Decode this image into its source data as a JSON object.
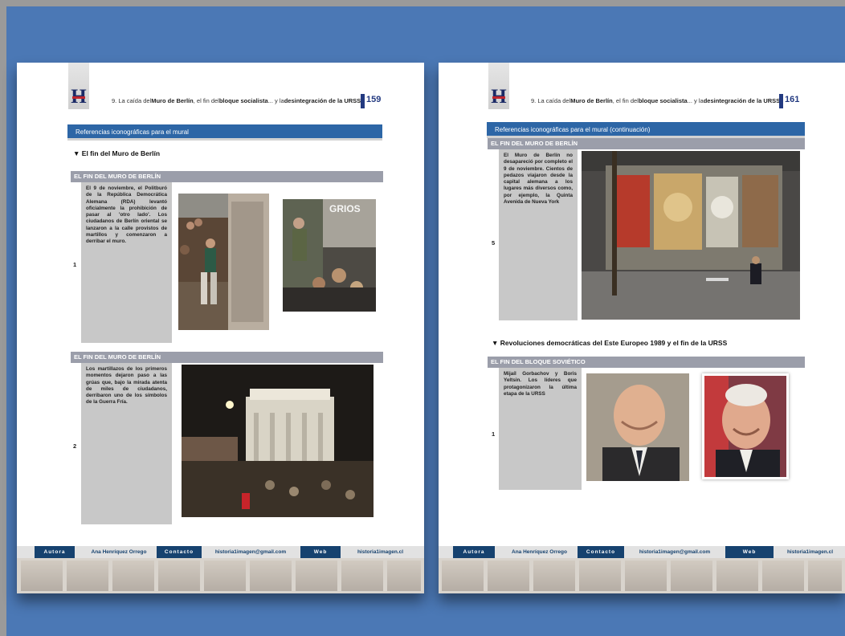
{
  "left_page": {
    "header": {
      "prefix": "9. La caída del",
      "b1": "Muro de Berlín",
      "mid1": ", el fin del",
      "b2": "bloque socialista",
      "mid2": "... y la",
      "b3": "desintegración de la URSS",
      "page_number": "159"
    },
    "banner": "Referencias iconográficas para el mural",
    "section_heading": "▼ El fin del Muro de Berlín",
    "rows": [
      {
        "header": "EL FIN DEL MURO DE BERLÍN",
        "number": "1",
        "text": "El 9 de noviembre, el Politburó de la República Democrática Alemana (RDA) levantó oficialmente la prohibición de pasar al 'otro lado'. Los ciudadanos de Berlín oriental se lanzaron a la calle provistos de martillos y comenzaron a derribar el muro.",
        "photo_caption": "GRIOS"
      },
      {
        "header": "EL FIN DEL MURO DE BERLÍN",
        "number": "2",
        "text": "Los martillazos de los primeros momentos dejaron paso a las grúas que, bajo la mirada atenta de miles de ciudadanos, derribaron uno de los símbolos de la Guerra Fría."
      }
    ]
  },
  "right_page": {
    "header": {
      "prefix": "9. La caída del",
      "b1": "Muro de Berlín",
      "mid1": ", el fin del",
      "b2": "bloque socialista",
      "mid2": "... y la",
      "b3": "desintegración de la URSS",
      "page_number": "161"
    },
    "banner": "Referencias iconográficas para el mural (continuación)",
    "row1": {
      "header": "EL FIN DEL MURO DE BERLÍN",
      "number": "5",
      "text": "El Muro de Berlín no desapareció por completo el 9 de noviembre. Cientos de pedazos viajaron desde la capital alemana a los lugares más diversos como, por ejemplo, la Quinta Avenida de Nueva York"
    },
    "section_heading": "▼ Revoluciones democráticas del Este Europeo 1989 y el fin de la URSS",
    "row2": {
      "header": "EL FIN DEL BLOQUE SOVIÉTICO",
      "number": "1",
      "text": "Mijaíl Gorbachov y Boris Yeltsin. Los líderes que protagonizaron la última etapa de la URSS"
    }
  },
  "footer": {
    "autora_label": "Autora",
    "autora_value": "Ana Henríquez Orrego",
    "contacto_label": "Contacto",
    "contacto_value": "historia1imagen@gmail.com",
    "web_label": "Web",
    "web_value": "historia1imagen.cl"
  }
}
